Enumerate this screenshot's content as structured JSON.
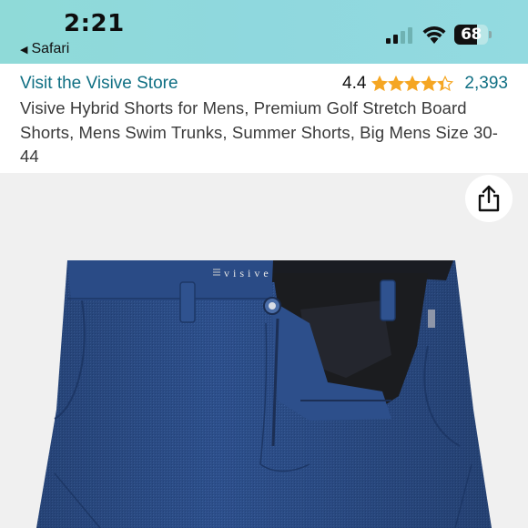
{
  "status_bar": {
    "time": "2:21",
    "back_app": "Safari",
    "battery_percent": "68",
    "battery_level": 0.68,
    "signal_bars_active": 2,
    "signal_bars_total": 4
  },
  "header": {
    "store_link": "Visit the Visive Store",
    "rating_value": "4.4",
    "stars": 4.4,
    "rating_count": "2,393",
    "title": "Visive Hybrid Shorts for Mens, Premium Golf Stretch Board Shorts, Mens Swim Trunks, Summer Shorts, Big Mens Size 30-44"
  },
  "image": {
    "brand_label": "visive",
    "share_icon": "share-icon"
  },
  "colors": {
    "link": "#0f6f83",
    "star": "#f5a623",
    "shorts_blue": "#2c4f8c",
    "status_bar_bg": "#8fdad8"
  }
}
